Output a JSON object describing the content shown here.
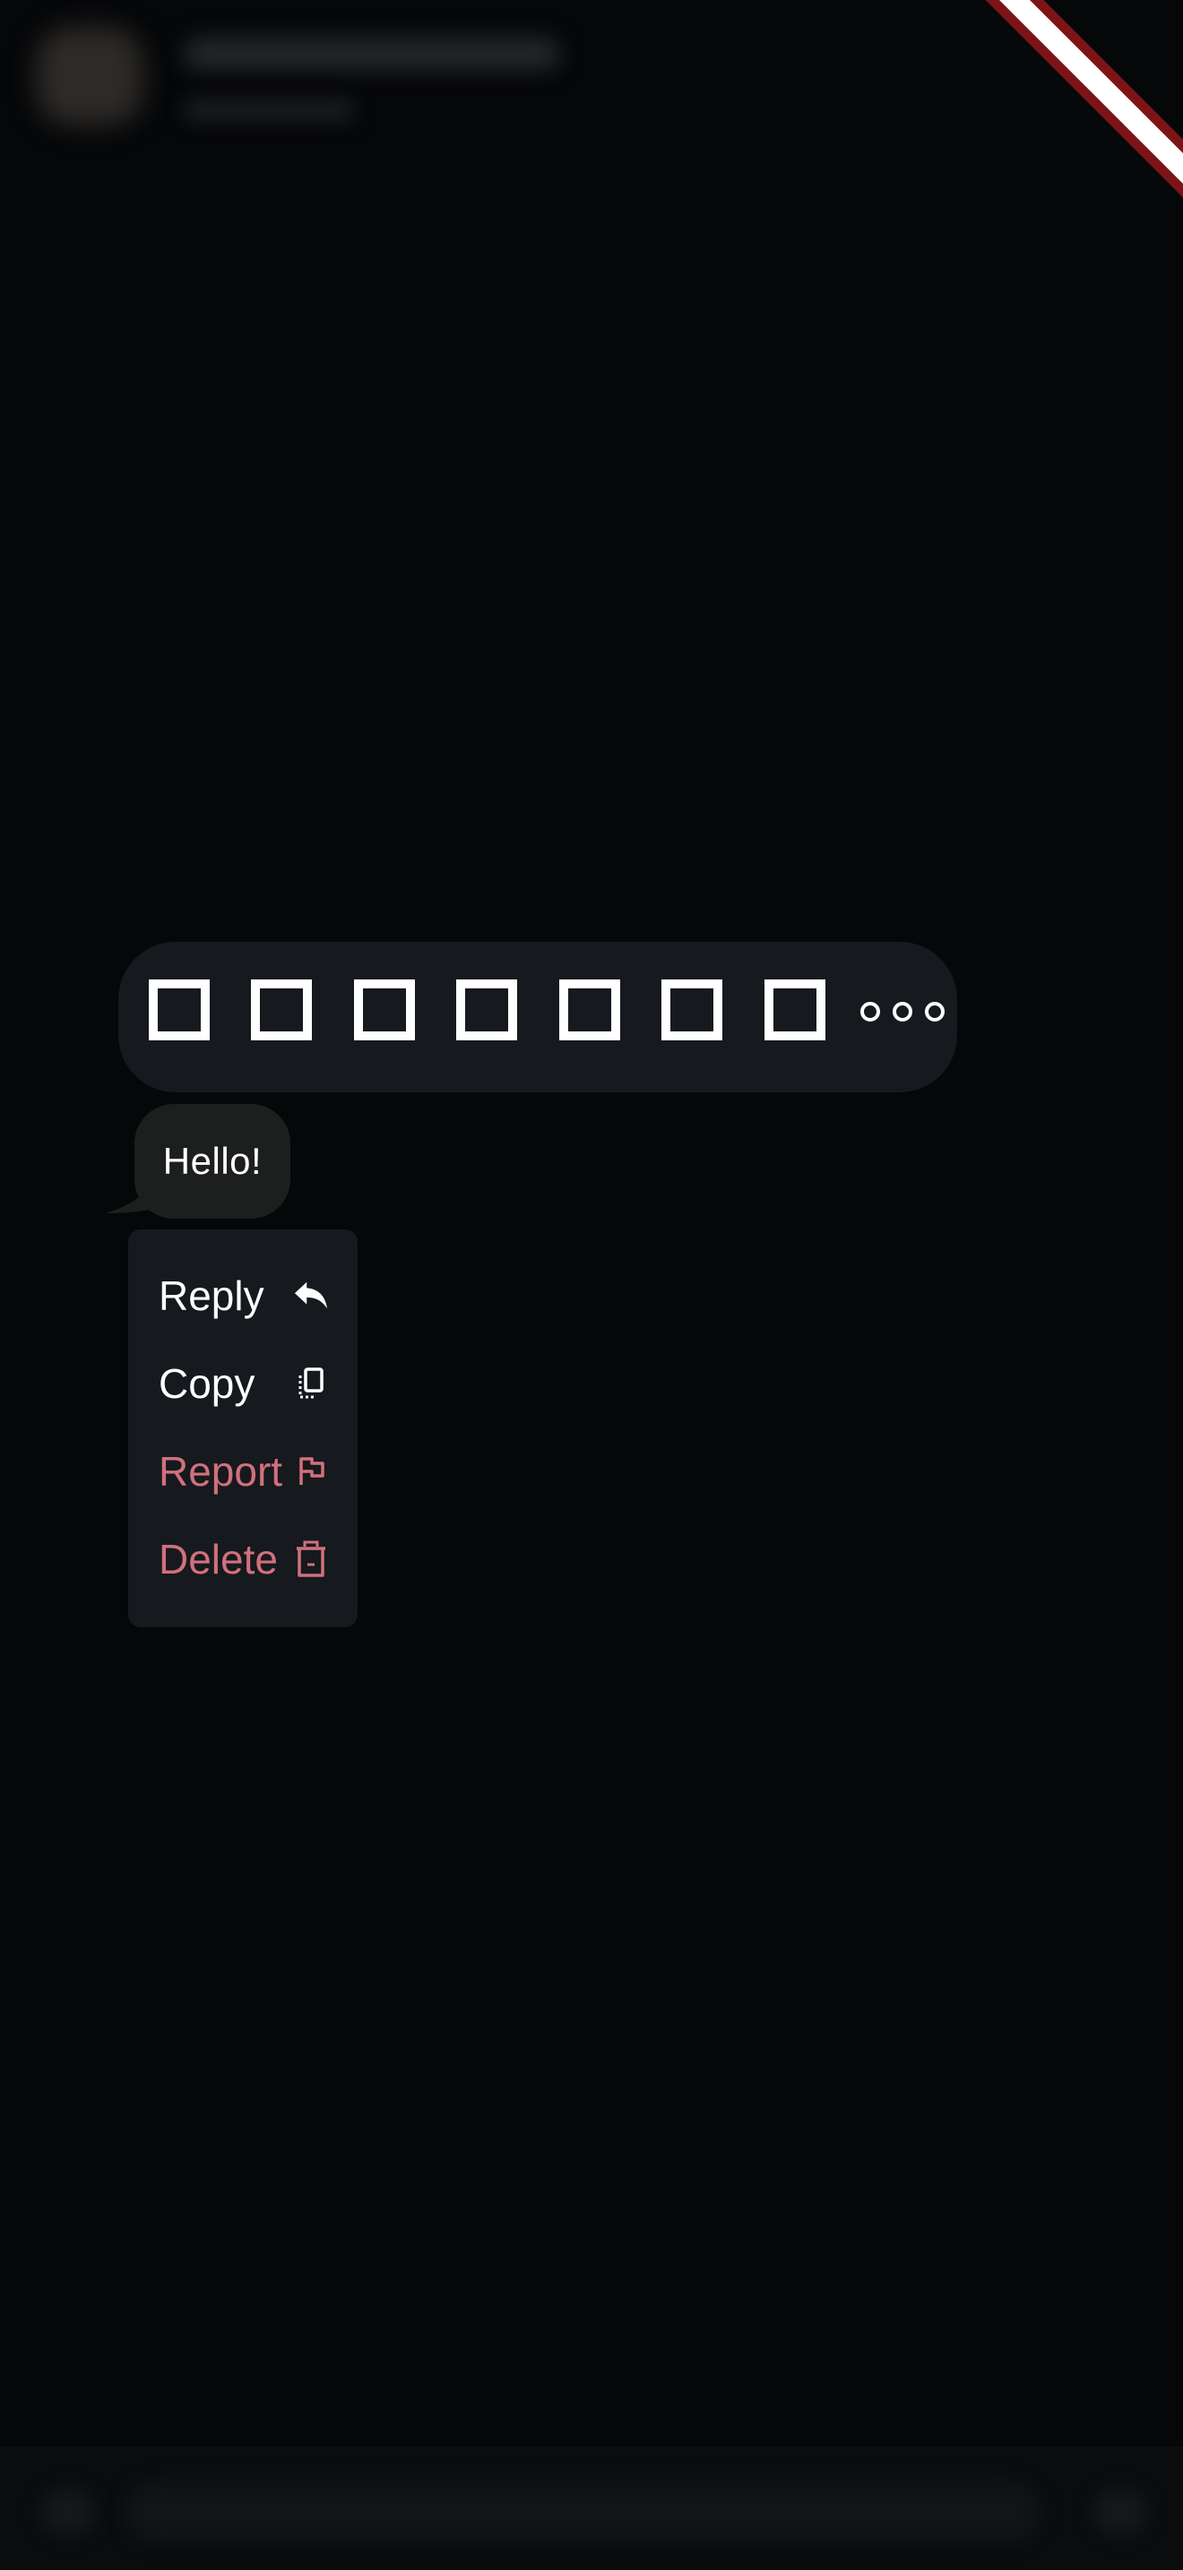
{
  "header": {
    "avatar_icon": "avatar-placeholder",
    "title": "",
    "subtitle": ""
  },
  "reactions": {
    "items": [
      {
        "icon": "missing-glyph-box"
      },
      {
        "icon": "missing-glyph-box"
      },
      {
        "icon": "missing-glyph-box"
      },
      {
        "icon": "missing-glyph-box"
      },
      {
        "icon": "missing-glyph-box"
      },
      {
        "icon": "missing-glyph-box"
      },
      {
        "icon": "missing-glyph-box"
      }
    ],
    "more_icon": "more-horizontal-icon"
  },
  "message": {
    "text": "Hello!"
  },
  "context_menu": {
    "items": [
      {
        "label": "Reply",
        "icon": "reply-icon",
        "style": "normal"
      },
      {
        "label": "Copy",
        "icon": "copy-icon",
        "style": "normal"
      },
      {
        "label": "Report",
        "icon": "flag-icon",
        "style": "danger"
      },
      {
        "label": "Delete",
        "icon": "trash-icon",
        "style": "danger"
      }
    ]
  },
  "colors": {
    "background": "#060709",
    "surface": "#16191d",
    "bubble": "#1c1f1d",
    "text": "#ffffff",
    "danger": "#d1707e",
    "ribbon": "#7c1417"
  }
}
